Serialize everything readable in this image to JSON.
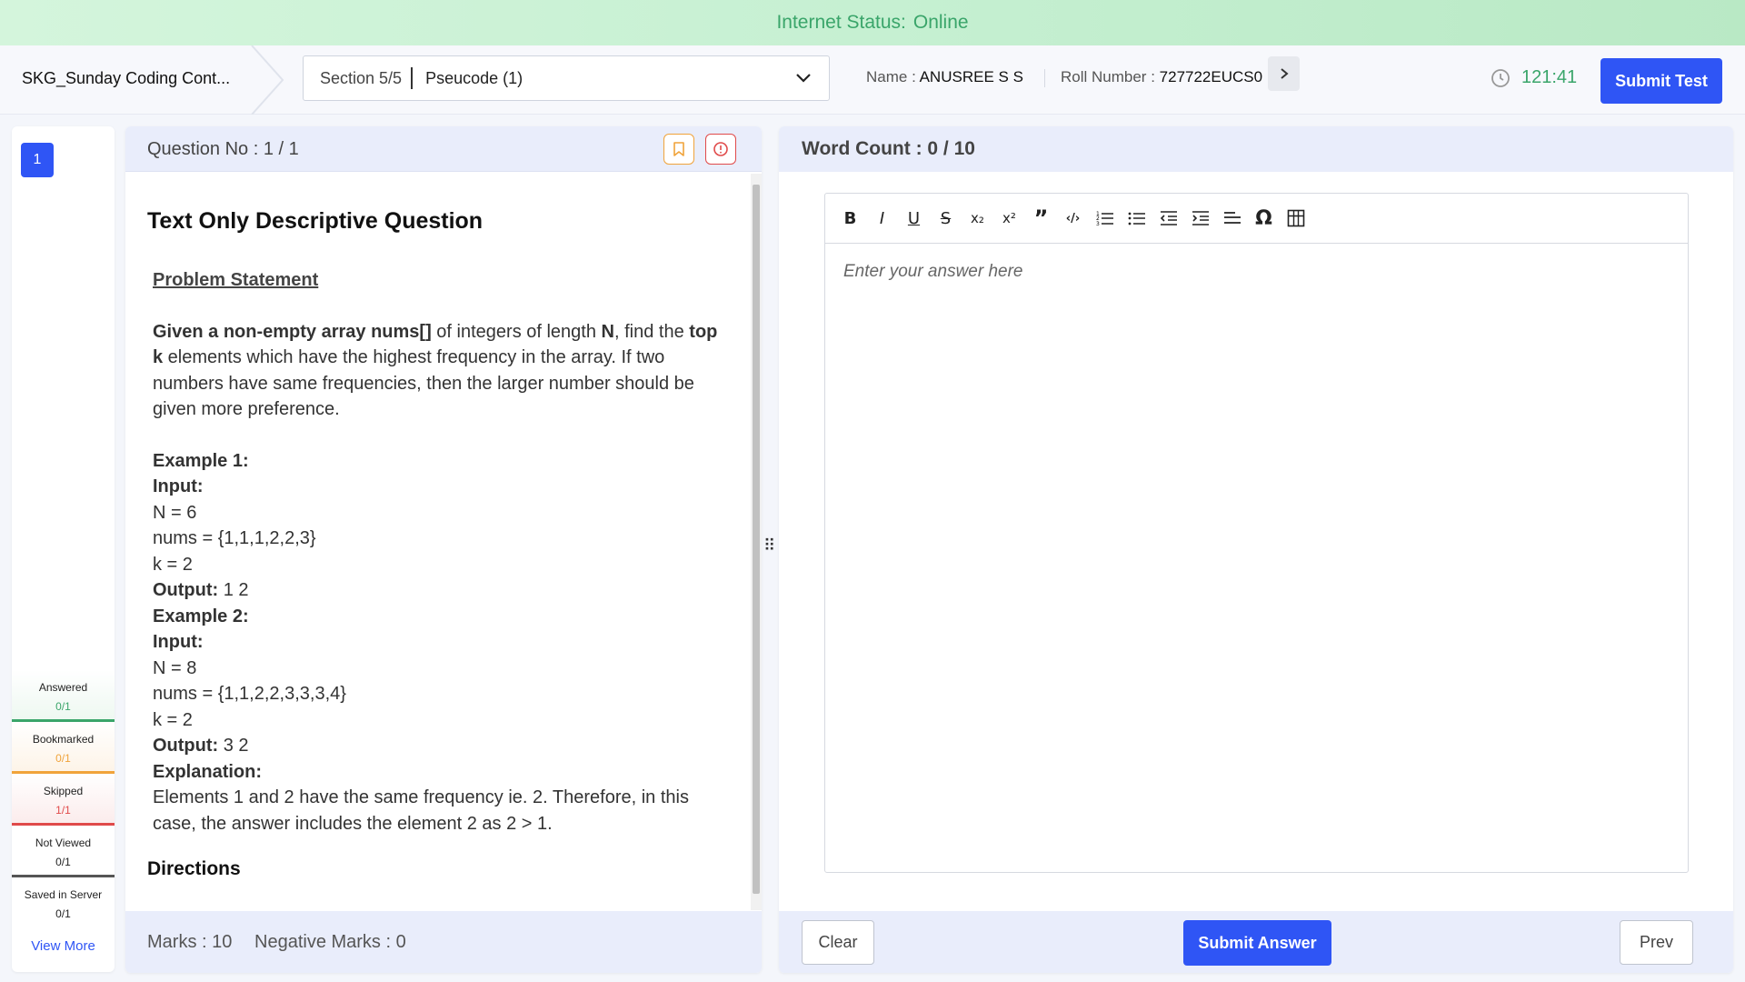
{
  "status": {
    "label": "Internet Status:",
    "value": "Online"
  },
  "header": {
    "contest_name": "SKG_Sunday Coding Cont...",
    "section": "Section 5/5",
    "subject": "Pseucode (1)",
    "name_label": "Name :",
    "name_value": "ANUSREE S S",
    "roll_label": "Roll Number :",
    "roll_value": "727722EUCS0",
    "timer": "121:41",
    "submit_test": "Submit Test"
  },
  "nav": {
    "question_numbers": [
      "1"
    ],
    "legend": [
      {
        "label": "Answered",
        "count": "0/1",
        "color": "#3aa56a"
      },
      {
        "label": "Bookmarked",
        "count": "0/1",
        "color": "#f0a33a"
      },
      {
        "label": "Skipped",
        "count": "1/1",
        "color": "#e04a4a"
      },
      {
        "label": "Not Viewed",
        "count": "0/1",
        "color": "#222222"
      },
      {
        "label": "Saved in Server",
        "count": "0/1",
        "color": "#222222"
      }
    ],
    "view_more": "View More"
  },
  "question": {
    "number_label": "Question No : 1 / 1",
    "title": "Text Only Descriptive Question",
    "problem_statement_heading": "Problem Statement",
    "p1_b1": "Given a non-empty array nums[]",
    "p1_t1": " of integers of length ",
    "p1_b2": "N",
    "p1_t2": ", find the ",
    "p1_b3": "top k",
    "p1_t3": " elements which have the highest frequency in the array. If two numbers have same frequencies, then the larger number should be given more preference.",
    "ex1_heading": "Example 1:",
    "input_label": "Input:",
    "ex1_n": "N = 6",
    "ex1_nums": "nums = {1,1,1,2,2,3}",
    "ex1_k": "k = 2",
    "output_label": "Output:",
    "ex1_output": " 1 2",
    "ex2_heading": "Example 2:",
    "ex2_n": "N = 8",
    "ex2_nums": "nums = {1,1,2,2,3,3,3,4}",
    "ex2_k": "k = 2",
    "ex2_output": " 3 2",
    "explanation_label": "Explanation:",
    "explanation": "Elements 1 and 2 have the same frequency ie. 2. Therefore, in this case, the answer includes the element 2 as 2 > 1.",
    "directions": "Directions",
    "marks": "Marks : 10",
    "negative_marks": "Negative Marks : 0"
  },
  "answer": {
    "word_count": "Word Count : 0 / 10",
    "placeholder": "Enter your answer here",
    "toolbar": [
      "B",
      "I",
      "U",
      "S",
      "x₂",
      "x²",
      "”",
      "‹/›",
      "ordered-list",
      "bullet-list",
      "outdent",
      "indent",
      "align",
      "Ω",
      "table"
    ],
    "clear": "Clear",
    "submit_answer": "Submit Answer",
    "prev": "Prev"
  }
}
